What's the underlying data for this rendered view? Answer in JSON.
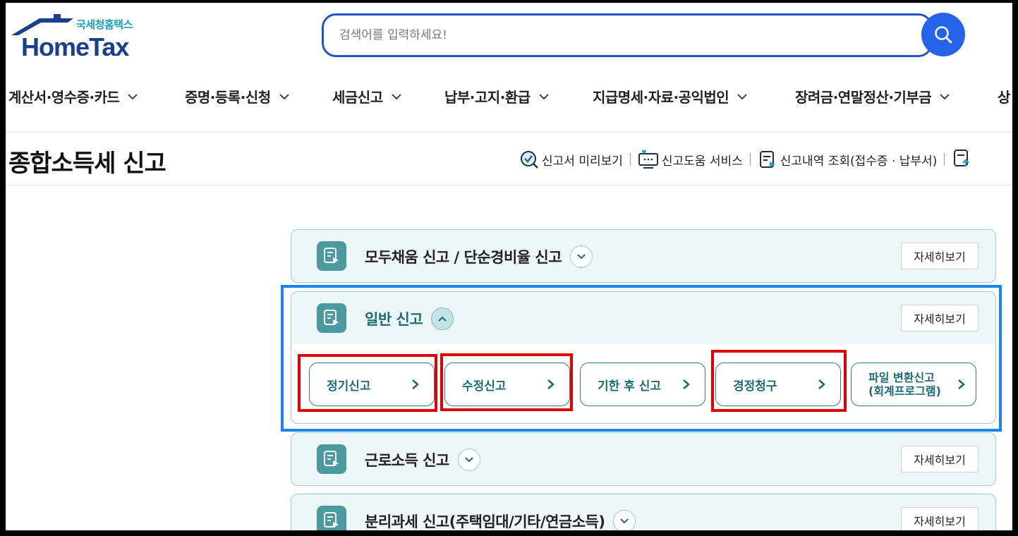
{
  "logo": {
    "sub": "국세청홈택스",
    "main": "HomeTax"
  },
  "search": {
    "placeholder": "검색어를 입력하세요!"
  },
  "nav": {
    "items": [
      {
        "label": "계산서·영수증·카드"
      },
      {
        "label": "증명·등록·신청"
      },
      {
        "label": "세금신고"
      },
      {
        "label": "납부·고지·환급"
      },
      {
        "label": "지급명세·자료·공익법인"
      },
      {
        "label": "장려금·연말정산·기부금"
      },
      {
        "label": "상"
      }
    ]
  },
  "page": {
    "title": "종합소득세 신고"
  },
  "quick_links": [
    {
      "label": "신고서 미리보기",
      "icon": "magnifier-check-icon"
    },
    {
      "label": "신고도움 서비스",
      "icon": "monitor-heart-icon"
    },
    {
      "label": "신고내역 조회(접수증 · 납부서)",
      "icon": "document-play-icon"
    }
  ],
  "sections": [
    {
      "title": "모두채움 신고 / 단순경비율 신고",
      "detail": "자세히보기",
      "open": false
    },
    {
      "title": "일반 신고",
      "detail": "자세히보기",
      "open": true,
      "buttons": [
        {
          "label": "정기신고"
        },
        {
          "label": "수정신고"
        },
        {
          "label": "기한 후 신고"
        },
        {
          "label": "경정청구"
        },
        {
          "label_line1": "파일 변환신고",
          "label_line2": "(회계프로그램)"
        }
      ]
    },
    {
      "title": "근로소득 신고",
      "detail": "자세히보기",
      "open": false
    },
    {
      "title": "분리과세 신고(주택임대/기타/연금소득)",
      "detail": "자세히보기",
      "open": false
    }
  ],
  "colors": {
    "accent_teal": "#1e6b75",
    "brand_blue": "#2563eb",
    "highlight_red": "#e00000",
    "highlight_blue": "#1b84e6"
  }
}
